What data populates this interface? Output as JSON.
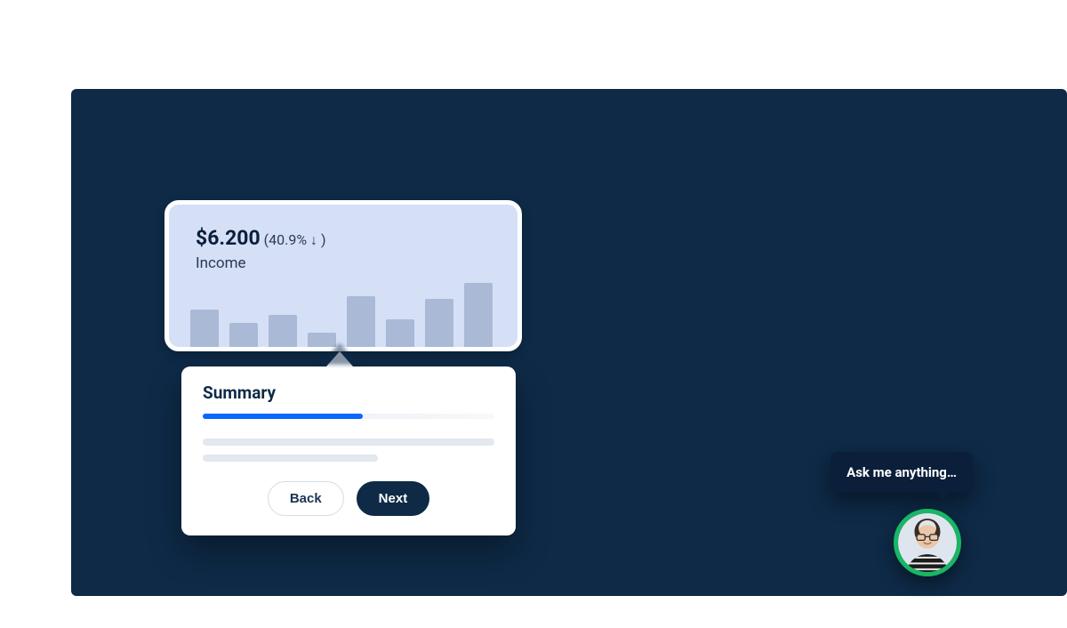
{
  "tipcard": {
    "amount": "$6.200",
    "delta": "(40.9% ↓ )",
    "label": "Income"
  },
  "popover": {
    "title": "Summary",
    "back_label": "Back",
    "next_label": "Next",
    "progress_percent": 55
  },
  "assistant": {
    "bubble_text": "Ask me anything…"
  },
  "chart_data": {
    "type": "bar",
    "title": "Income",
    "values": [
      47,
      30,
      40,
      18,
      63,
      34,
      60,
      80
    ],
    "ylim": [
      0,
      100
    ]
  }
}
